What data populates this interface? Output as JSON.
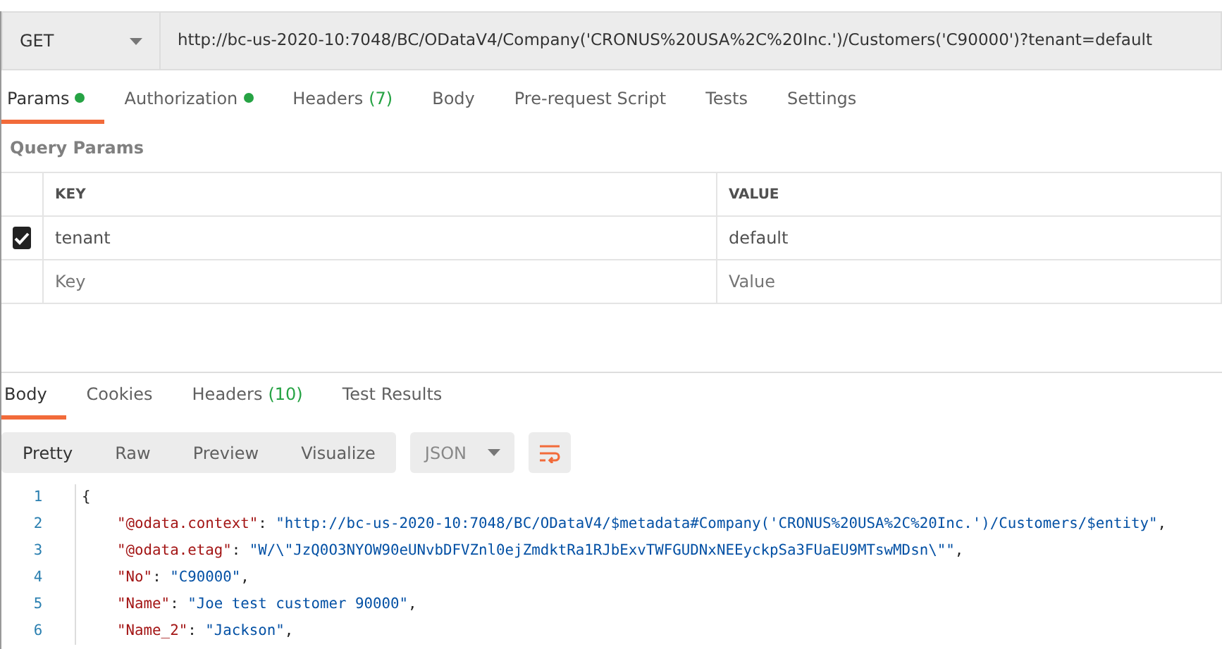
{
  "request": {
    "method": "GET",
    "url": "http://bc-us-2020-10:7048/BC/ODataV4/Company('CRONUS%20USA%2C%20Inc.')/Customers('C90000')?tenant=default"
  },
  "request_tabs": [
    {
      "label": "Params",
      "dot": true,
      "selected": true
    },
    {
      "label": "Authorization",
      "dot": true,
      "selected": false
    },
    {
      "label": "Headers",
      "count": "(7)",
      "dot": false,
      "selected": false
    },
    {
      "label": "Body",
      "dot": false,
      "selected": false
    },
    {
      "label": "Pre-request Script",
      "dot": false,
      "selected": false
    },
    {
      "label": "Tests",
      "dot": false,
      "selected": false
    },
    {
      "label": "Settings",
      "dot": false,
      "selected": false
    }
  ],
  "query_params": {
    "title": "Query Params",
    "columns": [
      "KEY",
      "VALUE"
    ],
    "rows": [
      {
        "key": "tenant",
        "value": "default",
        "checked": true
      }
    ],
    "new_row": {
      "key_placeholder": "Key",
      "value_placeholder": "Value"
    }
  },
  "response_tabs": [
    {
      "label": "Body",
      "selected": true
    },
    {
      "label": "Cookies",
      "selected": false
    },
    {
      "label": "Headers",
      "count": "(10)",
      "selected": false
    },
    {
      "label": "Test Results",
      "selected": false
    }
  ],
  "view_modes": [
    {
      "label": "Pretty",
      "selected": true
    },
    {
      "label": "Raw",
      "selected": false
    },
    {
      "label": "Preview",
      "selected": false
    },
    {
      "label": "Visualize",
      "selected": false
    }
  ],
  "format": "JSON",
  "code_lines": [
    {
      "number": "1",
      "kind": "brace",
      "text": "{"
    },
    {
      "number": "2",
      "kind": "pair",
      "key": "\"@odata.context\"",
      "sep": ":",
      "value": "\"http://bc-us-2020-10:7048/BC/ODataV4/$metadata#Company('CRONUS%20USA%2C%20Inc.')/Customers/$entity\"",
      "end": ","
    },
    {
      "number": "3",
      "kind": "pair",
      "key": "\"@odata.etag\"",
      "sep": ":",
      "value": "\"W/\\\"JzQ0O3NYOW90eUNvbDFVZnl0ejZmdktRa1RJbExvTWFGUDNxNEEyckpSa3FUaEU9MTswMDsn\\\"\"",
      "end": ","
    },
    {
      "number": "4",
      "kind": "pair",
      "key": "\"No\"",
      "sep": ":",
      "value": "\"C90000\"",
      "end": ","
    },
    {
      "number": "5",
      "kind": "pair",
      "key": "\"Name\"",
      "sep": ":",
      "value": "\"Joe test customer 90000\"",
      "end": ","
    },
    {
      "number": "6",
      "kind": "pair",
      "key": "\"Name_2\"",
      "sep": ":",
      "value": "\"Jackson\"",
      "end": ","
    }
  ]
}
